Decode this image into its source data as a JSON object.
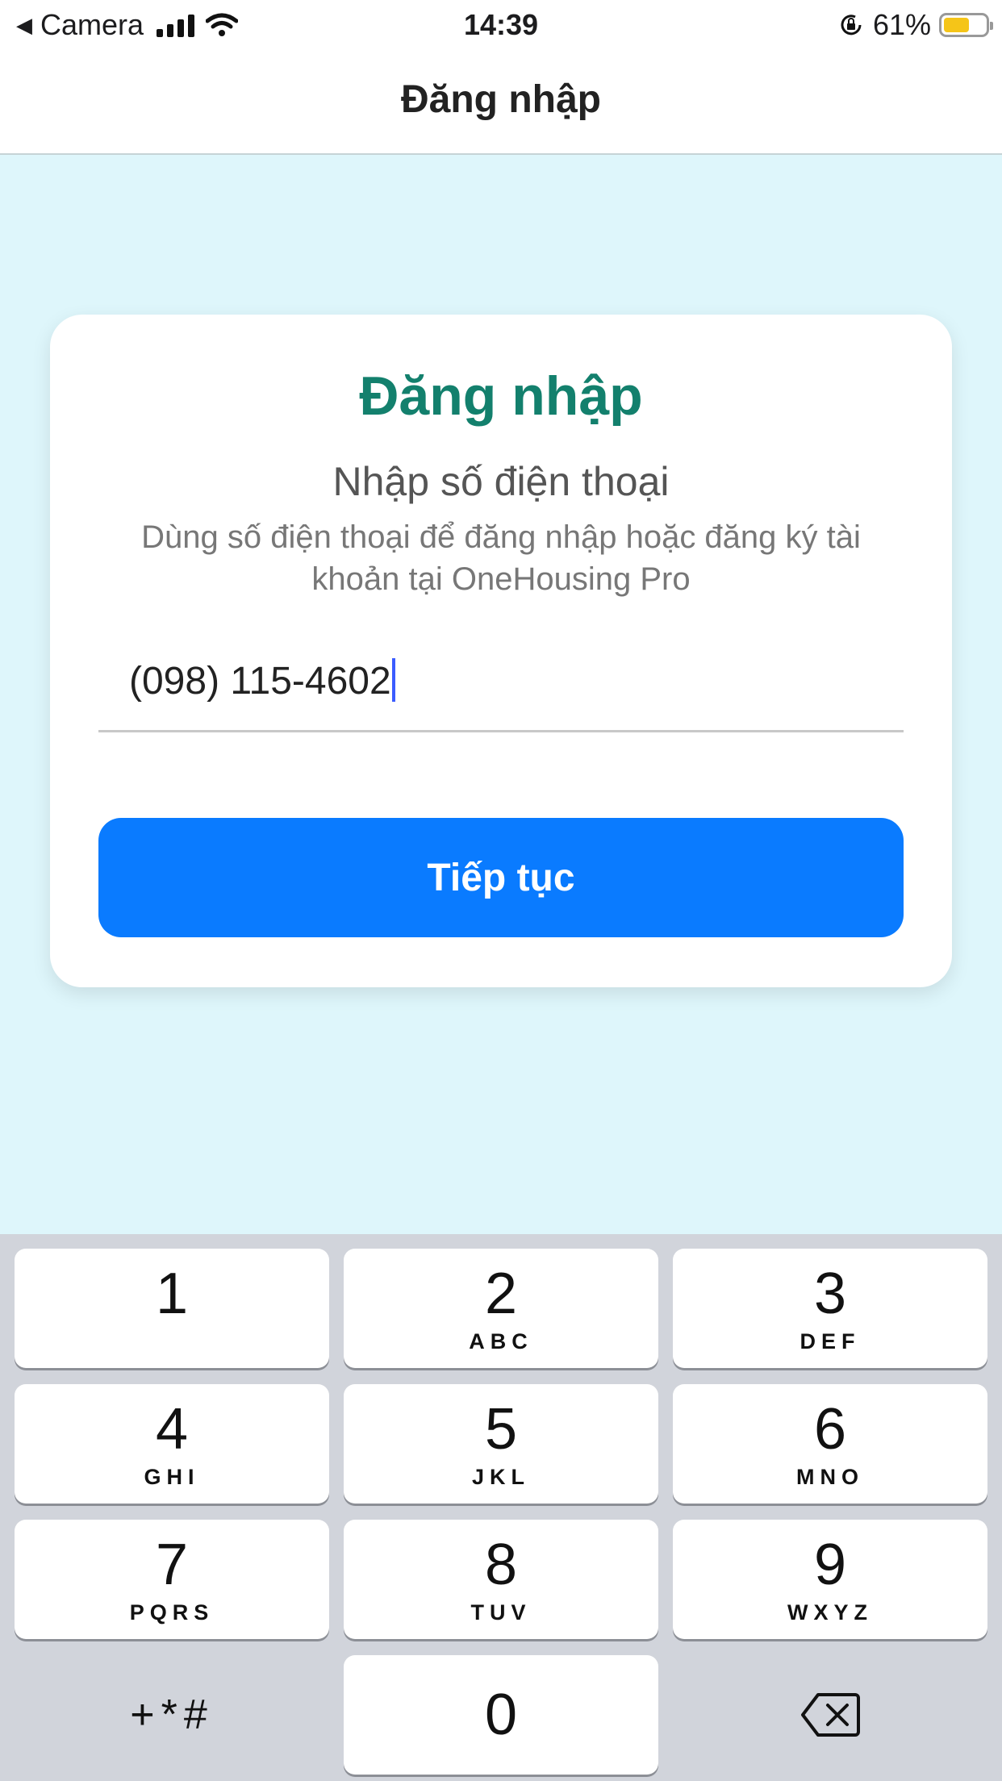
{
  "status_bar": {
    "back_label": "Camera",
    "time": "14:39",
    "battery": "61%",
    "battery_level": 0.61,
    "battery_color": "#f5c518"
  },
  "nav": {
    "title": "Đăng nhập"
  },
  "card": {
    "title": "Đăng nhập",
    "subtitle": "Nhập số điện thoại",
    "description": "Dùng số điện thoại để đăng nhập hoặc đăng ký tài khoản tại OneHousing Pro",
    "phone_value": "(098) 115-4602",
    "continue_label": "Tiếp tục",
    "title_color": "#13806d",
    "button_color": "#0a7bff"
  },
  "keypad": {
    "keys": [
      {
        "num": "1",
        "letters": ""
      },
      {
        "num": "2",
        "letters": "ABC"
      },
      {
        "num": "3",
        "letters": "DEF"
      },
      {
        "num": "4",
        "letters": "GHI"
      },
      {
        "num": "5",
        "letters": "JKL"
      },
      {
        "num": "6",
        "letters": "MNO"
      },
      {
        "num": "7",
        "letters": "PQRS"
      },
      {
        "num": "8",
        "letters": "TUV"
      },
      {
        "num": "9",
        "letters": "WXYZ"
      },
      {
        "num": "0",
        "letters": ""
      }
    ],
    "symbols_label": "+*#",
    "delete_icon": "backspace-icon"
  }
}
